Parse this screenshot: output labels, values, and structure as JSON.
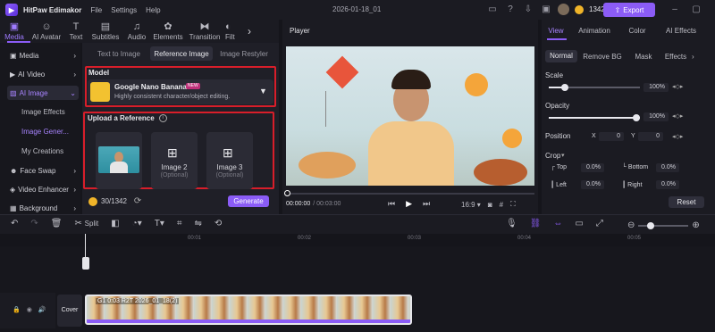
{
  "app": {
    "name": "HitPaw Edimakor",
    "project_title": "2026-01-18_01"
  },
  "menu": [
    "File",
    "Settings",
    "Help"
  ],
  "header": {
    "credits": "1342",
    "export_label": "Export"
  },
  "top_tabs": [
    {
      "label": "Media",
      "icon": "media-icon"
    },
    {
      "label": "AI Avatar",
      "icon": "avatar-icon"
    },
    {
      "label": "Text",
      "icon": "text-icon"
    },
    {
      "label": "Subtitles",
      "icon": "subtitles-icon"
    },
    {
      "label": "Audio",
      "icon": "audio-icon"
    },
    {
      "label": "Elements",
      "icon": "elements-icon"
    },
    {
      "label": "Transition",
      "icon": "transition-icon"
    },
    {
      "label": "Filt",
      "icon": "filter-icon"
    }
  ],
  "sidebar": {
    "items": [
      "Media",
      "AI Video",
      "AI Image",
      "Face Swap",
      "Video Enhancer",
      "Background"
    ],
    "ai_image_sub": [
      "Image Effects",
      "Image Gener...",
      "My Creations"
    ]
  },
  "panel": {
    "subtabs": [
      "Text to Image",
      "Reference Image",
      "Image Restyler"
    ],
    "model_label": "Model",
    "model_name": "Google Nano Banana",
    "model_badge": "NEW",
    "model_desc": "Highly consistent character/object editing.",
    "upload_label": "Upload a Reference",
    "slots": [
      {
        "label": "Image 2",
        "sub": "(Optional)"
      },
      {
        "label": "Image 3",
        "sub": "(Optional)"
      }
    ],
    "credits": "30/1342",
    "generate_label": "Generate"
  },
  "player": {
    "title": "Player",
    "current_time": "00:00:00",
    "total_time": "/ 00:03:00",
    "aspect": "16:9"
  },
  "right_panel": {
    "tabs": [
      "View",
      "Animation",
      "Color",
      "AI Effects"
    ],
    "subtabs": [
      "Normal",
      "Remove BG",
      "Mask",
      "Effects"
    ],
    "scale_label": "Scale",
    "scale_value": "100%",
    "opacity_label": "Opacity",
    "opacity_value": "100%",
    "position_label": "Position",
    "x_label": "X",
    "x_value": "0",
    "y_label": "Y",
    "y_value": "0",
    "crop_label": "Crop",
    "crop_top": "Top",
    "crop_top_v": "0.0%",
    "crop_bottom": "Bottom",
    "crop_bottom_v": "0.0%",
    "crop_left": "Left",
    "crop_left_v": "0.0%",
    "crop_right": "Right",
    "crop_right_v": "0.0%",
    "reset_label": "Reset"
  },
  "toolbar": {
    "split_label": "Split"
  },
  "timeline": {
    "ruler": [
      "00:01",
      "00:02",
      "00:03",
      "00:04",
      "00:05"
    ],
    "cover_label": "Cover",
    "clip_label": "G1 0:03 R2T 2026_01_18(2)"
  },
  "colors": {
    "accent": "#8b5cf6",
    "highlight_box": "#d81e2a"
  }
}
